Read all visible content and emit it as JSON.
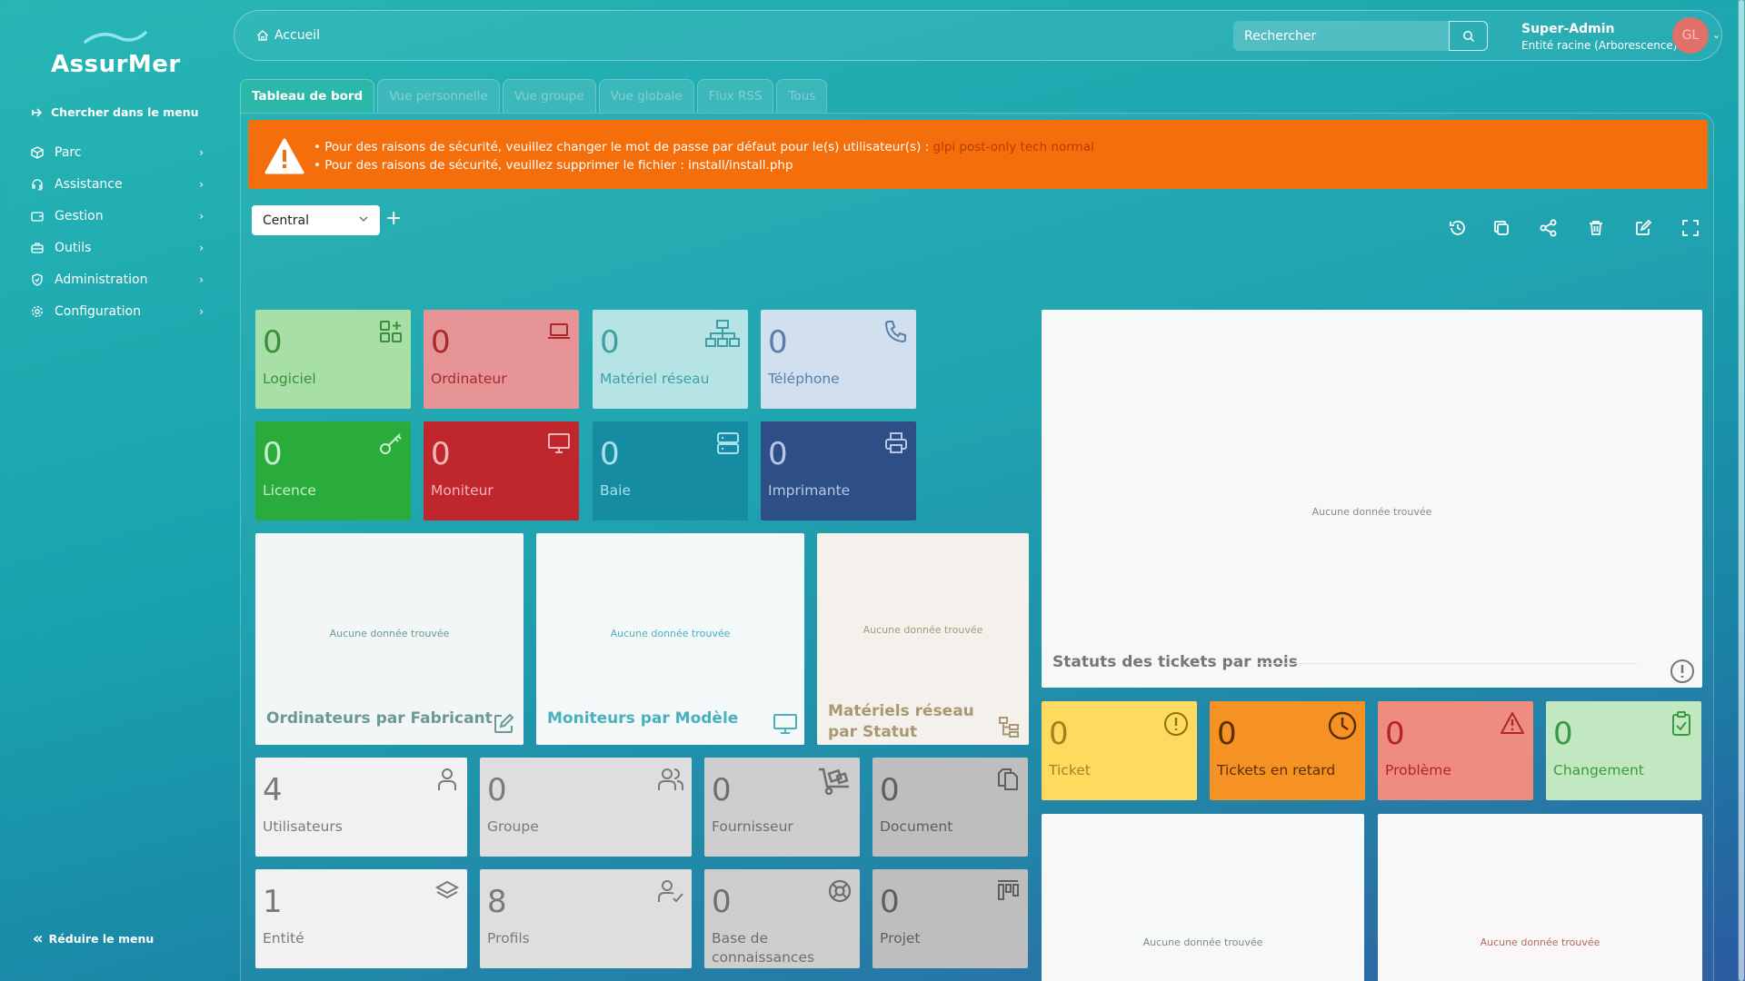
{
  "sidebar": {
    "logo_text": "AssurMer",
    "search_menu": "Chercher dans le menu",
    "items": [
      {
        "label": "Parc"
      },
      {
        "label": "Assistance"
      },
      {
        "label": "Gestion"
      },
      {
        "label": "Outils"
      },
      {
        "label": "Administration"
      },
      {
        "label": "Configuration"
      }
    ],
    "collapse": "Réduire le menu"
  },
  "header": {
    "breadcrumb": "Accueil",
    "search_placeholder": "Rechercher",
    "user_name": "Super-Admin",
    "user_entity": "Entité racine (Arborescence)",
    "avatar_initials": "GL"
  },
  "tabs": [
    {
      "label": "Tableau de bord",
      "active": true
    },
    {
      "label": "Vue personnelle"
    },
    {
      "label": "Vue groupe"
    },
    {
      "label": "Vue globale"
    },
    {
      "label": "Flux RSS"
    },
    {
      "label": "Tous"
    }
  ],
  "alert": {
    "line1_text": "Pour des raisons de sécurité, veuillez changer le mot de passe par défaut pour le(s) utilisateur(s) : ",
    "line1_link": "glpi post-only tech normal",
    "line2": "Pour des raisons de sécurité, veuillez supprimer le fichier : install/install.php"
  },
  "dashboard": {
    "selected": "Central",
    "add": "+"
  },
  "cards": {
    "logiciel": {
      "value": "0",
      "label": "Logiciel"
    },
    "ordinateur": {
      "value": "0",
      "label": "Ordinateur"
    },
    "materiel_reseau": {
      "value": "0",
      "label": "Matériel réseau"
    },
    "telephone": {
      "value": "0",
      "label": "Téléphone"
    },
    "licence": {
      "value": "0",
      "label": "Licence"
    },
    "moniteur": {
      "value": "0",
      "label": "Moniteur"
    },
    "baie": {
      "value": "0",
      "label": "Baie"
    },
    "imprimante": {
      "value": "0",
      "label": "Imprimante"
    },
    "utilisateurs": {
      "value": "4",
      "label": "Utilisateurs"
    },
    "groupe": {
      "value": "0",
      "label": "Groupe"
    },
    "fournisseur": {
      "value": "0",
      "label": "Fournisseur"
    },
    "document": {
      "value": "0",
      "label": "Document"
    },
    "entite": {
      "value": "1",
      "label": "Entité"
    },
    "profils": {
      "value": "8",
      "label": "Profils"
    },
    "base_connaissances": {
      "value": "0",
      "label": "Base de connaissances"
    },
    "projet": {
      "value": "0",
      "label": "Projet"
    },
    "ticket": {
      "value": "0",
      "label": "Ticket"
    },
    "tickets_retard": {
      "value": "0",
      "label": "Tickets en retard"
    },
    "probleme": {
      "value": "0",
      "label": "Problème"
    },
    "changement": {
      "value": "0",
      "label": "Changement"
    }
  },
  "charts": {
    "empty": "Aucune donnée trouvée",
    "ordinateurs_fabricant": "Ordinateurs par Fabricant",
    "moniteurs_modele": "Moniteurs par Modèle",
    "materiels_reseau_statut": "Matériels réseau par Statut",
    "statuts_tickets_mois": "Statuts des tickets par mois"
  },
  "colors": {
    "alert": "#f56e0c",
    "accent": "#2cb8a8"
  }
}
